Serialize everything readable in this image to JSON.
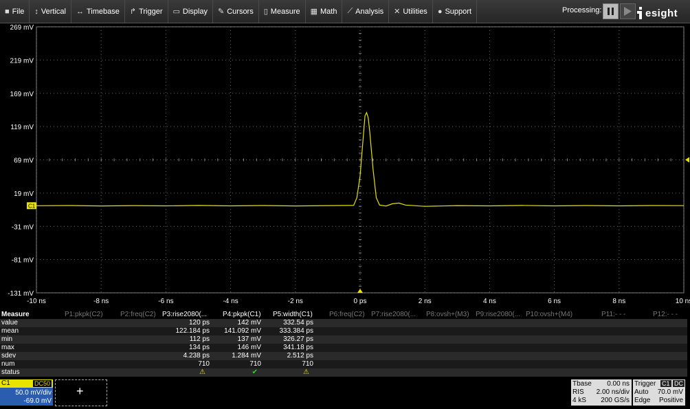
{
  "menu": [
    {
      "label": "File",
      "icon": "file-icon",
      "glyph": "■"
    },
    {
      "label": "Vertical",
      "icon": "vertical-icon",
      "glyph": "↕"
    },
    {
      "label": "Timebase",
      "icon": "timebase-icon",
      "glyph": "↔"
    },
    {
      "label": "Trigger",
      "icon": "trigger-icon",
      "glyph": "↱"
    },
    {
      "label": "Display",
      "icon": "display-icon",
      "glyph": "▭"
    },
    {
      "label": "Cursors",
      "icon": "cursors-icon",
      "glyph": "✎"
    },
    {
      "label": "Measure",
      "icon": "measure-icon",
      "glyph": "▯"
    },
    {
      "label": "Math",
      "icon": "math-icon",
      "glyph": "▦"
    },
    {
      "label": "Analysis",
      "icon": "analysis-icon",
      "glyph": "⟋"
    },
    {
      "label": "Utilities",
      "icon": "utilities-icon",
      "glyph": "✕"
    },
    {
      "label": "Support",
      "icon": "support-icon",
      "glyph": "●"
    }
  ],
  "processing_label": "Processing:",
  "logo_text": "esight",
  "colors": {
    "trace": "#e8e400",
    "grid": "#6a6a6a",
    "accent": "#2a5db0"
  },
  "chart_data": {
    "type": "line",
    "xlabel": "",
    "ylabel": "",
    "xlim": [
      -10,
      10
    ],
    "ylim": [
      -131,
      269
    ],
    "x_ticks": [
      "-10 ns",
      "-8 ns",
      "-6 ns",
      "-4 ns",
      "-2 ns",
      "0 ps",
      "2 ns",
      "4 ns",
      "6 ns",
      "8 ns",
      "10 ns"
    ],
    "y_ticks": [
      "269 mV",
      "219 mV",
      "169 mV",
      "119 mV",
      "69 mV",
      "19 mV",
      "-31 mV",
      "-81 mV",
      "-131 mV"
    ],
    "series": [
      {
        "points": [
          [
            -10,
            0
          ],
          [
            -9,
            0.3
          ],
          [
            -8,
            -0.4
          ],
          [
            -7,
            0.2
          ],
          [
            -6,
            -0.3
          ],
          [
            -5,
            0.4
          ],
          [
            -4,
            -0.2
          ],
          [
            -3,
            0.3
          ],
          [
            -2,
            -0.4
          ],
          [
            -1,
            0.2
          ],
          [
            -0.2,
            0.5
          ],
          [
            -0.1,
            12
          ],
          [
            0,
            45
          ],
          [
            0.1,
            105
          ],
          [
            0.15,
            135
          ],
          [
            0.2,
            140
          ],
          [
            0.25,
            132
          ],
          [
            0.3,
            110
          ],
          [
            0.4,
            55
          ],
          [
            0.5,
            12
          ],
          [
            0.6,
            1
          ],
          [
            0.8,
            -0.5
          ],
          [
            1,
            3
          ],
          [
            1.2,
            4
          ],
          [
            1.4,
            1
          ],
          [
            2,
            -1
          ],
          [
            3,
            0.2
          ],
          [
            4,
            -0.3
          ],
          [
            5,
            0.4
          ],
          [
            6,
            -0.3
          ],
          [
            7,
            0.3
          ],
          [
            8,
            -0.2
          ],
          [
            9,
            0.3
          ],
          [
            10,
            0.1
          ]
        ]
      }
    ],
    "channel_marker": "C1"
  },
  "measure": {
    "title": "Measure",
    "headers": [
      "P1:pkpk(C2)",
      "P2:freq(C2)",
      "P3:rise2080(...",
      "P4:pkpk(C1)",
      "P5:width(C1)",
      "P6:freq(C2)",
      "P7:rise2080(...",
      "P8:ovsh+(M3)",
      "P9:rise2080(...",
      "P10:ovsh+(M4)",
      "P11:- - -",
      "P12:- - -"
    ],
    "rows": [
      {
        "label": "value",
        "p3": "120 ps",
        "p4": "142 mV",
        "p5": "332.54 ps"
      },
      {
        "label": "mean",
        "p3": "122.184 ps",
        "p4": "141.092 mV",
        "p5": "333.384 ps"
      },
      {
        "label": "min",
        "p3": "112 ps",
        "p4": "137 mV",
        "p5": "326.27 ps"
      },
      {
        "label": "max",
        "p3": "134 ps",
        "p4": "146 mV",
        "p5": "341.18 ps"
      },
      {
        "label": "sdev",
        "p3": "4.238 ps",
        "p4": "1.284 mV",
        "p5": "2.512 ps"
      },
      {
        "label": "num",
        "p3": "710",
        "p4": "710",
        "p5": "710"
      },
      {
        "label": "status",
        "p3": "⚠",
        "p4": "✔",
        "p5": "⚠"
      }
    ]
  },
  "channel": {
    "label": "C1",
    "coupling": "DC50",
    "vdiv": "50.0 mV/div",
    "offset": "-69.0 mV"
  },
  "add_label": "+",
  "timebase": {
    "title": "Tbase",
    "delay": "0.00 ns",
    "mode": "RIS",
    "tdiv": "2.00 ns/div",
    "samples": "4 kS",
    "rate": "200 GS/s"
  },
  "trigger": {
    "title": "Trigger",
    "ch": "C1",
    "coupling": "DC",
    "mode": "Auto",
    "level": "70.0 mV",
    "type": "Edge",
    "slope": "Positive"
  }
}
